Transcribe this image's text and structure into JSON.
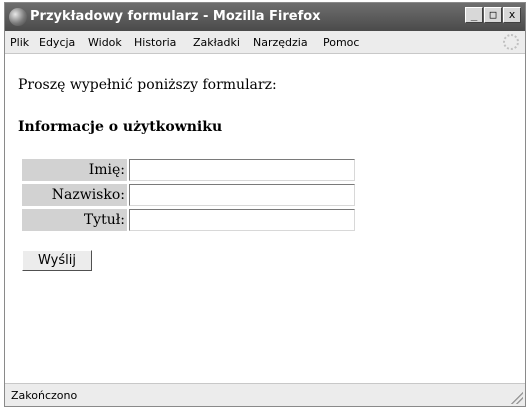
{
  "window": {
    "title": "Przykładowy formularz - Mozilla Firefox",
    "minimize_symbol": "_",
    "maximize_symbol": "□",
    "close_symbol": "x"
  },
  "menubar": {
    "items": [
      {
        "label": "Plik"
      },
      {
        "label": "Edycja"
      },
      {
        "label": "Widok"
      },
      {
        "label": "Historia"
      },
      {
        "label": "Zakładki"
      },
      {
        "label": "Narzędzia"
      },
      {
        "label": "Pomoc"
      }
    ]
  },
  "page": {
    "prompt": "Proszę wypełnić poniższy formularz:",
    "section_title": "Informacje o użytkowniku",
    "form": {
      "fields": [
        {
          "label": "Imię:",
          "value": ""
        },
        {
          "label": "Nazwisko:",
          "value": ""
        },
        {
          "label": "Tytuł:",
          "value": ""
        }
      ],
      "submit_label": "Wyślij"
    }
  },
  "status": {
    "text": "Zakończono"
  },
  "colors": {
    "titlebar": "#4a4a4a",
    "label_background": "#d2d2d2"
  }
}
